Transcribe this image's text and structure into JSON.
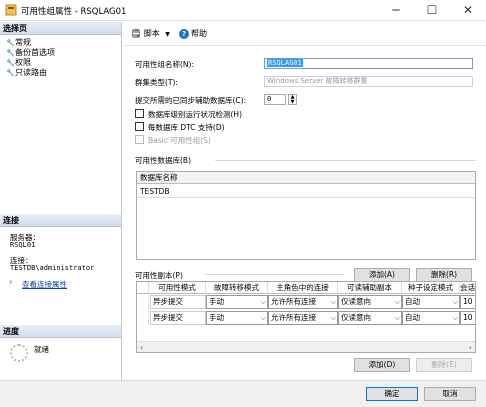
{
  "window": {
    "title": "可用性组属性 - RSQLAG01",
    "minimize": "─",
    "maximize": "☐",
    "close": "✕"
  },
  "left": {
    "select_page_header": "选择页",
    "pages": [
      "常规",
      "备份首选项",
      "权限",
      "只读路由"
    ],
    "connection_header": "连接",
    "server_label": "服务器：",
    "server_value": "RSQL01",
    "connection_label": "连接：",
    "connection_value": "TESTDB\\administrator",
    "view_conn_props": "查看连接属性",
    "progress_header": "进度",
    "progress_status": "就绪"
  },
  "toolbar": {
    "script_label": "脚本",
    "script_dropdown": "▼",
    "help_label": "帮助"
  },
  "general": {
    "ag_name_label": "可用性组名称(N):",
    "ag_name_value": "RSQLAG01",
    "cluster_type_label": "群集类型(T):",
    "cluster_type_value": "Windows Server 故障转移群集",
    "required_sync_label": "提交所需的已同步辅助数据库(C):",
    "required_sync_value": "0",
    "db_health_label": "数据库级别运行状况检测(H)",
    "per_db_dtc_label": "每数据库 DTC 支持(D)",
    "basic_ag_label": "Basic 可用性组(S)"
  },
  "databases": {
    "group_label": "可用性数据库(B)",
    "column": "数据库名称",
    "rows": [
      "TESTDB"
    ],
    "add_button": "添加(A)",
    "remove_button": "删除(R)"
  },
  "replicas": {
    "group_label": "可用性副本(P)",
    "columns": [
      "可用性模式",
      "故障转移模式",
      "主角色中的连接",
      "可读辅助副本",
      "种子设定模式",
      "会话"
    ],
    "rows": [
      {
        "availability_mode": "异步提交",
        "failover_mode": "手动",
        "primary_connections": "允许所有连接",
        "readable_secondary": "仅读意向",
        "seeding_mode": "自动",
        "session_timeout": "10"
      },
      {
        "availability_mode": "异步提交",
        "failover_mode": "手动",
        "primary_connections": "允许所有连接",
        "readable_secondary": "仅读意向",
        "seeding_mode": "自动",
        "session_timeout": "10"
      }
    ],
    "add_button": "添加(D)",
    "remove_button": "删除(E)"
  },
  "footer": {
    "ok": "确定",
    "cancel": "取消"
  }
}
